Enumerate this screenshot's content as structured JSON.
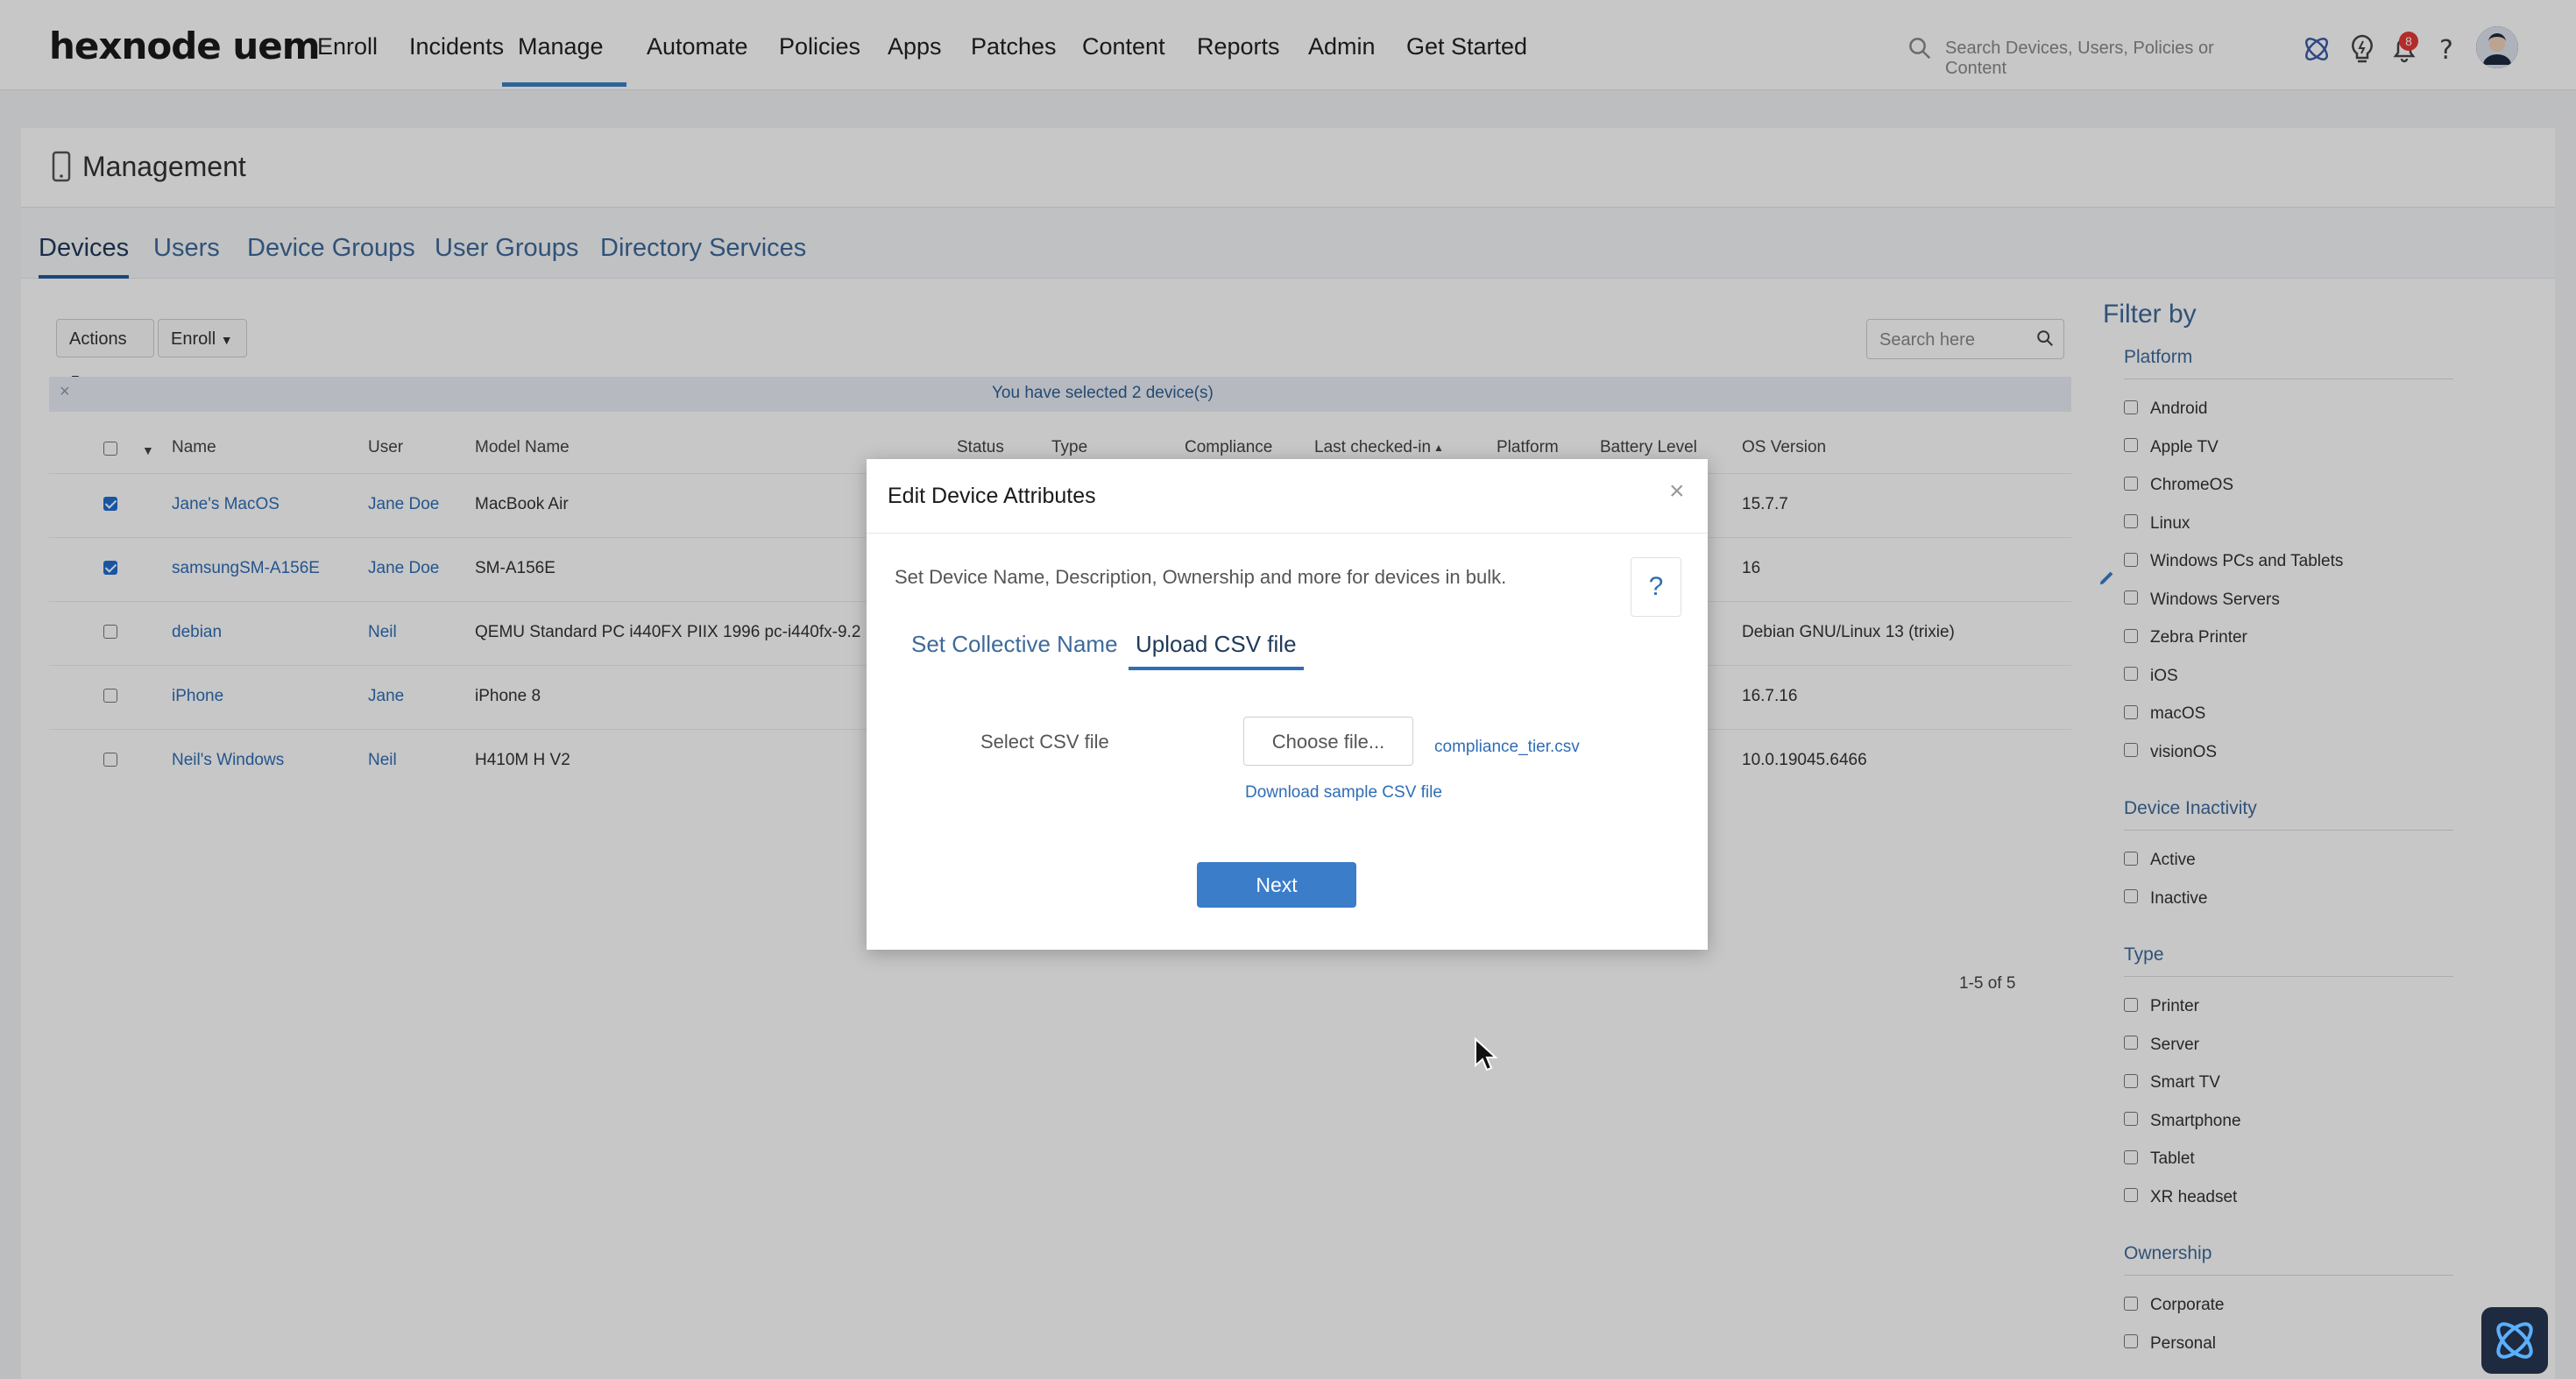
{
  "brand": {
    "logo": "hexnode uem"
  },
  "nav": {
    "items": [
      {
        "label": "Enroll"
      },
      {
        "label": "Incidents"
      },
      {
        "label": "Manage"
      },
      {
        "label": "Automate"
      },
      {
        "label": "Policies"
      },
      {
        "label": "Apps"
      },
      {
        "label": "Patches"
      },
      {
        "label": "Content"
      },
      {
        "label": "Reports"
      },
      {
        "label": "Admin"
      },
      {
        "label": "Get Started"
      }
    ],
    "active": "Manage",
    "search_placeholder": "Search Devices, Users, Policies or Content",
    "notification_count": "8"
  },
  "page": {
    "title": "Management"
  },
  "tabs": [
    {
      "label": "Devices"
    },
    {
      "label": "Users"
    },
    {
      "label": "Device Groups"
    },
    {
      "label": "User Groups"
    },
    {
      "label": "Directory Services"
    }
  ],
  "toolbar": {
    "actions_label": "Actions",
    "enroll_label": "Enroll",
    "search_placeholder": "Search here"
  },
  "selection": {
    "message": "You have selected 2 device(s)",
    "close": "×"
  },
  "table": {
    "headers": {
      "name": "Name",
      "user": "User",
      "model": "Model Name",
      "status": "Status",
      "type": "Type",
      "compliance": "Compliance",
      "last_checked": "Last checked-in",
      "platform": "Platform",
      "battery": "Battery Level",
      "os": "OS Version"
    },
    "rows": [
      {
        "name": "Jane's MacOS",
        "user": "Jane Doe",
        "model": "MacBook Air",
        "os": "15.7.7",
        "checked": true
      },
      {
        "name": "samsungSM-A156E",
        "user": "Jane Doe",
        "model": "SM-A156E",
        "os": "16",
        "checked": true
      },
      {
        "name": "debian",
        "user": "Neil",
        "model": "QEMU Standard PC i440FX PIIX 1996 pc-i440fx-9.2",
        "os": "Debian GNU/Linux 13 (trixie)",
        "checked": false
      },
      {
        "name": "iPhone",
        "user": "Jane",
        "model": "iPhone 8",
        "os": "16.7.16",
        "checked": false
      },
      {
        "name": "Neil's Windows",
        "user": "Neil",
        "model": "H410M H V2",
        "os": "10.0.19045.6466",
        "checked": false
      }
    ],
    "pagination": "1-5 of 5"
  },
  "filter": {
    "title": "Filter by",
    "sections": {
      "platform": {
        "title": "Platform",
        "options": [
          "Android",
          "Apple TV",
          "ChromeOS",
          "Linux",
          "Windows PCs and Tablets",
          "Windows Servers",
          "Zebra Printer",
          "iOS",
          "macOS",
          "visionOS"
        ]
      },
      "inactivity": {
        "title": "Device Inactivity",
        "options": [
          "Active",
          "Inactive"
        ]
      },
      "type": {
        "title": "Type",
        "options": [
          "Printer",
          "Server",
          "Smart TV",
          "Smartphone",
          "Tablet",
          "XR headset"
        ]
      },
      "ownership": {
        "title": "Ownership",
        "options": [
          "Corporate",
          "Personal"
        ]
      }
    }
  },
  "modal": {
    "title": "Edit Device Attributes",
    "close": "×",
    "description": "Set Device Name, Description, Ownership and more for devices in bulk.",
    "help": "?",
    "tabs": [
      "Set Collective Name",
      "Upload CSV file"
    ],
    "active_tab": "Upload CSV file",
    "select_label": "Select CSV file",
    "choose_button": "Choose file...",
    "file_name": "compliance_tier.csv",
    "download_link": "Download sample CSV file",
    "next_button": "Next"
  }
}
